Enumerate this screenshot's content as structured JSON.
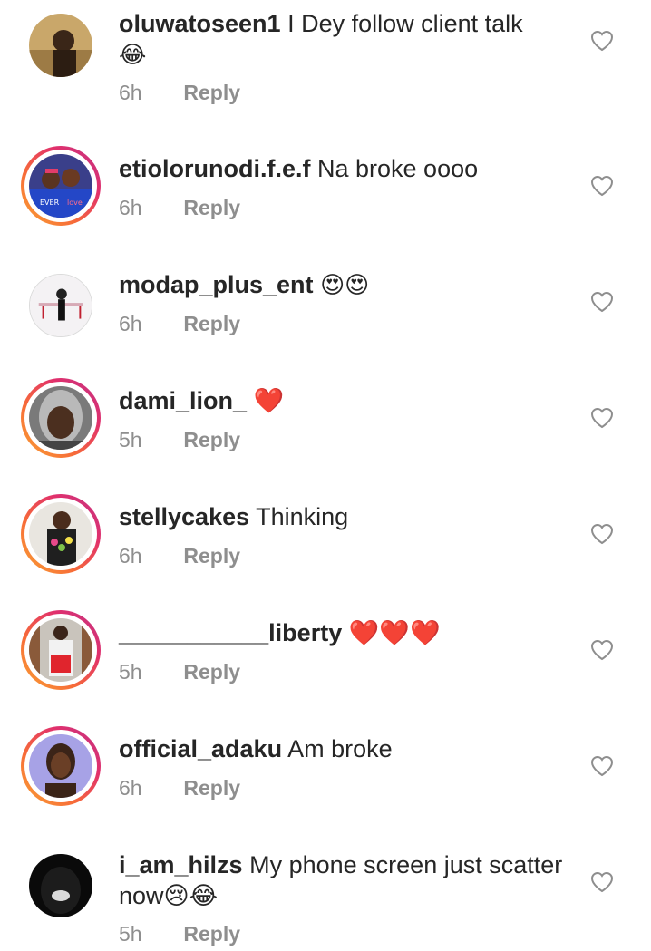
{
  "comments": [
    {
      "username": "oluwatoseen1",
      "text": "I Dey follow client talk",
      "emoji_line": "😂",
      "time": "6h",
      "reply_label": "Reply",
      "story": false
    },
    {
      "username": "etiolorunodi.f.e.f",
      "text": "Na broke oooo",
      "emoji_line": "",
      "time": "6h",
      "reply_label": "Reply",
      "story": true
    },
    {
      "username": "modap_plus_ent",
      "text": "😍😍",
      "emoji_line": "",
      "time": "6h",
      "reply_label": "Reply",
      "story": false
    },
    {
      "username": "dami_lion_",
      "text": "❤️",
      "emoji_line": "",
      "time": "5h",
      "reply_label": "Reply",
      "story": true
    },
    {
      "username": "stellycakes",
      "text": "Thinking",
      "emoji_line": "",
      "time": "6h",
      "reply_label": "Reply",
      "story": true
    },
    {
      "username": "___________liberty",
      "text": "❤️❤️❤️",
      "emoji_line": "",
      "time": "5h",
      "reply_label": "Reply",
      "story": true
    },
    {
      "username": "official_adaku",
      "text": "Am broke",
      "emoji_line": "",
      "time": "6h",
      "reply_label": "Reply",
      "story": true
    },
    {
      "username": "i_am_hilzs",
      "text": "My phone screen just scatter",
      "emoji_line": "now😢😂",
      "time": "5h",
      "reply_label": "Reply",
      "story": false
    }
  ],
  "icons": {
    "like": "heart-outline-icon"
  }
}
